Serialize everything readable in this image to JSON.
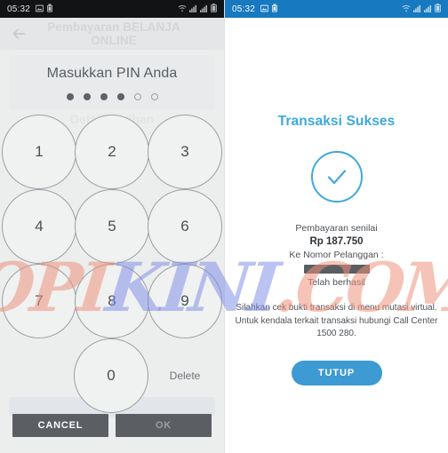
{
  "left_screen": {
    "statusbar": {
      "time": "05:32",
      "left_icons": [
        "image-icon",
        "usb-icon"
      ],
      "right_icons": [
        "wifi-icon",
        "signal-icon",
        "signal-icon",
        "battery-icon"
      ],
      "background": "#111315"
    },
    "appbar": {
      "back_icon": "back-arrow-icon",
      "title": "Pembayaran BELANJA ONLINE"
    },
    "pin_card": {
      "title": "Masukkan PIN Anda",
      "dots_total": 6,
      "dots_filled": 4,
      "ghost_text": "Detail Tagihan"
    },
    "keypad": {
      "rows": [
        [
          "1",
          "2",
          "3"
        ],
        [
          "4",
          "5",
          "6"
        ],
        [
          "7",
          "8",
          "9"
        ]
      ],
      "zero": "0",
      "delete_label": "Delete"
    },
    "buttons": {
      "cancel": "CANCEL",
      "ok": "OK"
    }
  },
  "right_screen": {
    "statusbar": {
      "time": "05:32",
      "left_icons": [
        "image-icon",
        "usb-icon"
      ],
      "right_icons": [
        "wifi-icon",
        "signal-icon",
        "signal-icon",
        "battery-icon"
      ],
      "background": "#1779bf"
    },
    "success": {
      "title": "Transaksi Sukses",
      "check_icon": "check-circle-icon",
      "accent_color": "#41a7dd",
      "detail_line1": "Pembayaran senilai",
      "amount": "Rp 187.750",
      "detail_line2": "Ke Nomor Pelanggan :",
      "redacted": "",
      "detail_line3": "Telah berhasil",
      "note_line1": "Silahkan cek bukti transaksi di menu mutasi virtual.",
      "note_line2": "Untuk kendala terkait transaksi hubungi Call Center",
      "note_line3": "1500 280.",
      "close_button": "TUTUP"
    }
  },
  "watermark": {
    "part_a": "OPI",
    "part_b": "KINI",
    "part_c": ".COM",
    "color_a": "#ec927c",
    "color_b": "#7c8ce7"
  }
}
